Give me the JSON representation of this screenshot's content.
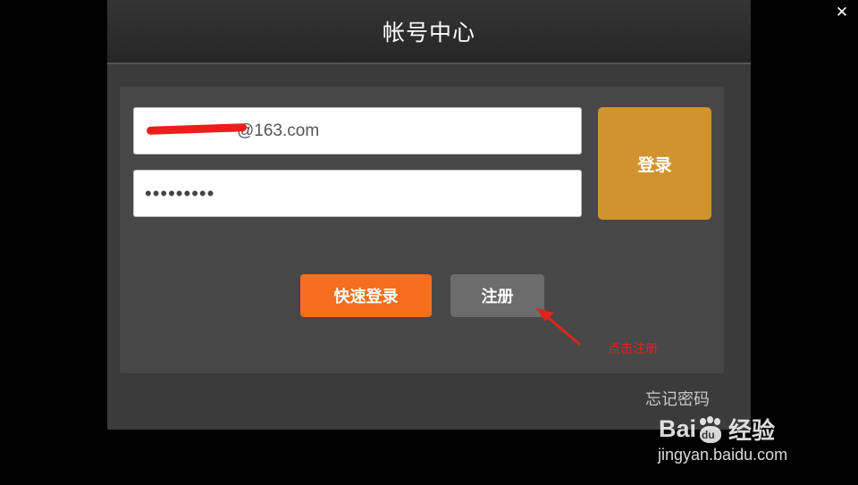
{
  "window": {
    "close_glyph": "✕"
  },
  "dialog": {
    "title": "帐号中心",
    "username_value": "@163.com",
    "password_value": "•••••••••",
    "login_label": "登录",
    "quick_login_label": "快速登录",
    "register_label": "注册",
    "forgot_label": "忘记密码"
  },
  "annotation": {
    "text": "点击注册",
    "color": "#e0241a"
  },
  "watermark": {
    "brand_left": "Bai",
    "brand_paw_text": "du",
    "brand_right": "经验",
    "url": "jingyan.baidu.com"
  },
  "colors": {
    "login": "#d19230",
    "quick_login": "#f46e1d",
    "register": "#6c6c6c",
    "redaction": "#ee1c1c"
  },
  "icons": [
    "close-icon",
    "red-arrow-icon",
    "baidu-paw-icon"
  ]
}
